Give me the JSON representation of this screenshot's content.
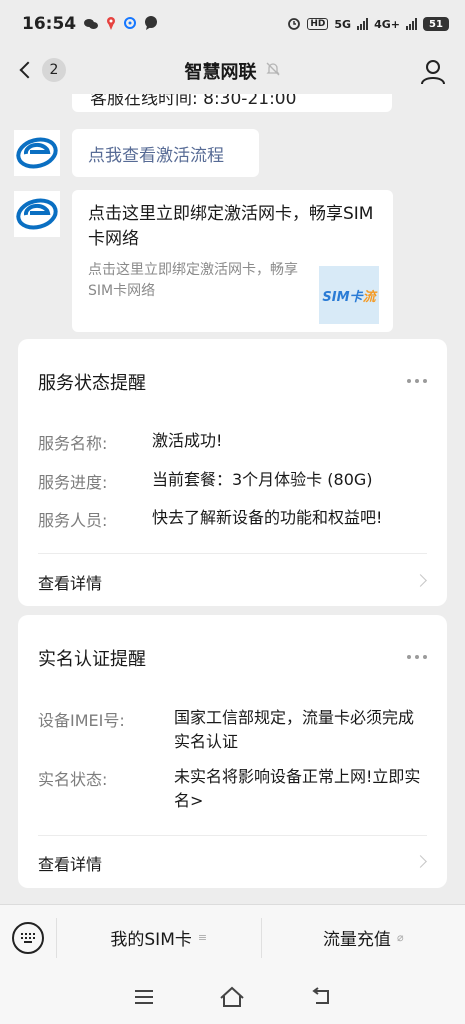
{
  "status_bar": {
    "time": "16:54",
    "network_5g": "5G",
    "network_4g": "4G+",
    "battery": "51",
    "hd": "HD"
  },
  "nav": {
    "back_badge": "2",
    "title": "智慧网联"
  },
  "messages": {
    "partial_text": "客服在线时间: 8:30-21:00",
    "link_text": "点我查看激活流程",
    "card_title": "点击这里立即绑定激活网卡，畅享SIM卡网络",
    "card_sub": "点击这里立即绑定激活网卡，畅享SIM卡网络",
    "thumb_text_a": "SIM卡",
    "thumb_text_b": "流"
  },
  "service_notice": {
    "title": "服务状态提醒",
    "rows": [
      {
        "label": "服务名称:",
        "value": "激活成功!"
      },
      {
        "label": "服务进度:",
        "value": "当前套餐：3个月体验卡 (80G)"
      },
      {
        "label": "服务人员:",
        "value": "快去了解新设备的功能和权益吧!"
      }
    ],
    "detail": "查看详情"
  },
  "realname_notice": {
    "title": "实名认证提醒",
    "rows": [
      {
        "label": "设备IMEI号:",
        "value": "国家工信部规定，流量卡必须完成实名认证"
      },
      {
        "label": "实名状态:",
        "value": "未实名将影响设备正常上网!立即实名>"
      }
    ],
    "detail": "查看详情"
  },
  "menu": {
    "item1": "我的SIM卡",
    "item1_glyph": "≡",
    "item2": "流量充值",
    "item2_glyph": "⌀"
  },
  "colors": {
    "background": "#ededed",
    "link": "#576b95",
    "avatar_brand": "#0a6fc2"
  }
}
